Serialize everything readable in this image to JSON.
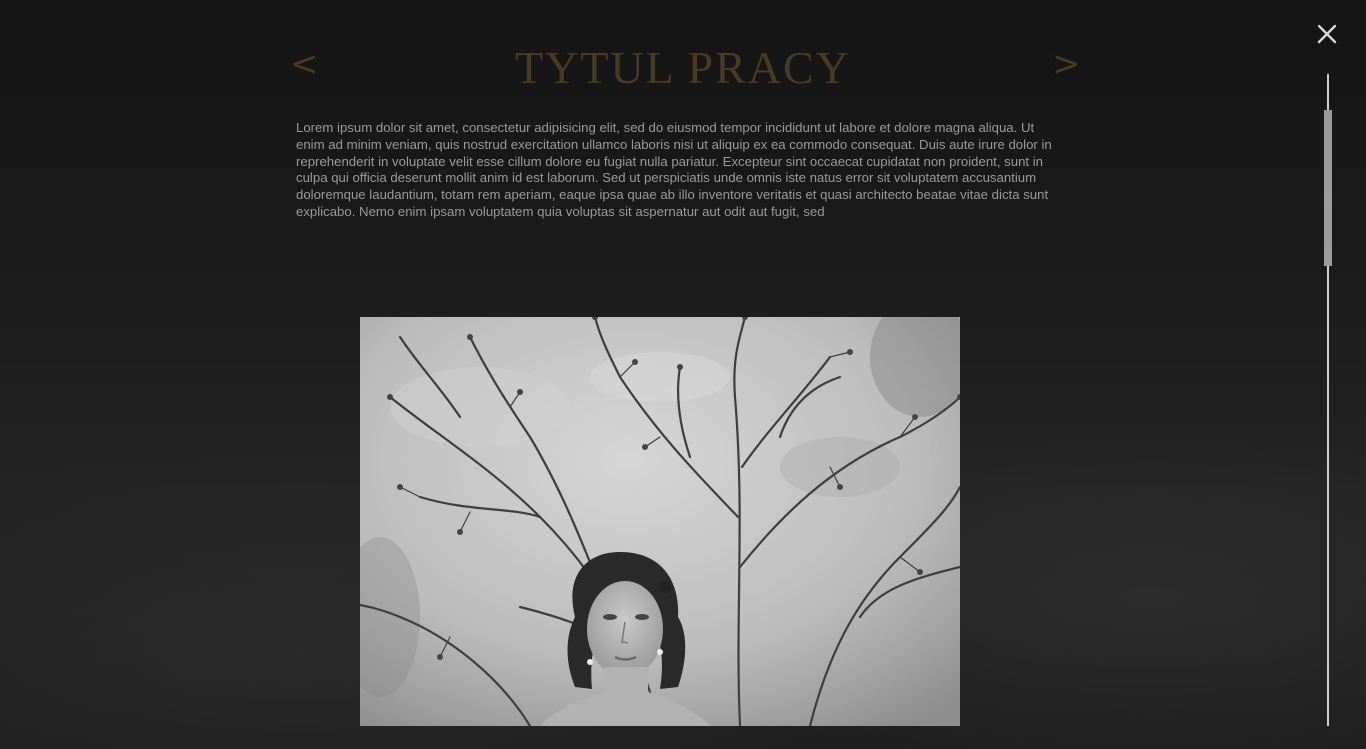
{
  "colors": {
    "accent": "#4b3a22",
    "text": "#9a9a9a",
    "close": "#d8d8d8",
    "scroll_track": "#cfcfcf",
    "scroll_thumb": "#9b9b9b"
  },
  "nav": {
    "prev_label": "<",
    "next_label": ">"
  },
  "work": {
    "title": "TYTUL PRACY",
    "description": "Lorem ipsum dolor sit amet, consectetur adipisicing elit, sed do eiusmod tempor incididunt ut labore et dolore magna aliqua. Ut enim ad minim veniam, quis nostrud exercitation ullamco laboris nisi ut aliquip ex ea commodo consequat. Duis aute irure dolor in reprehenderit in voluptate velit esse cillum dolore eu fugiat nulla pariatur. Excepteur sint occaecat cupidatat non proident, sunt in culpa qui officia deserunt mollit anim id est laborum. Sed ut perspiciatis unde omnis iste natus error sit voluptatem accusantium doloremque laudantium, totam rem aperiam, eaque ipsa quae ab illo inventore veritatis et quasi architecto beatae vitae dicta sunt explicabo. Nemo enim ipsam voluptatem quia voluptas sit aspernatur aut odit aut fugit, sed",
    "photo_icon": "portrait-photo"
  },
  "icons": {
    "close": "close-icon"
  }
}
